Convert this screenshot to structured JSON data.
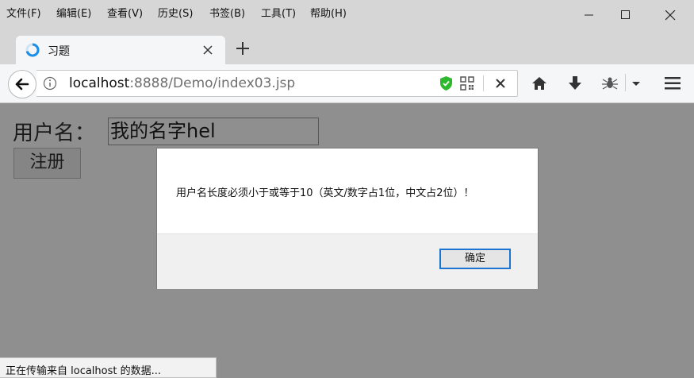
{
  "menubar": {
    "items": [
      "文件(F)",
      "编辑(E)",
      "查看(V)",
      "历史(S)",
      "书签(B)",
      "工具(T)",
      "帮助(H)"
    ]
  },
  "tab": {
    "title": "习题"
  },
  "address": {
    "host": "localhost",
    "rest": ":8888/Demo/index03.jsp"
  },
  "page": {
    "username_label": "用户名：",
    "username_value": "我的名字hel",
    "register_label": "注册"
  },
  "dialog": {
    "message": "用户名长度必须小于或等于10（英文/数字占1位，中文占2位）！",
    "ok_label": "确定"
  },
  "status": {
    "text": "正在传输来自 localhost 的数据..."
  },
  "colors": {
    "accent": "#1b73d2",
    "shield": "#2eb82e"
  }
}
